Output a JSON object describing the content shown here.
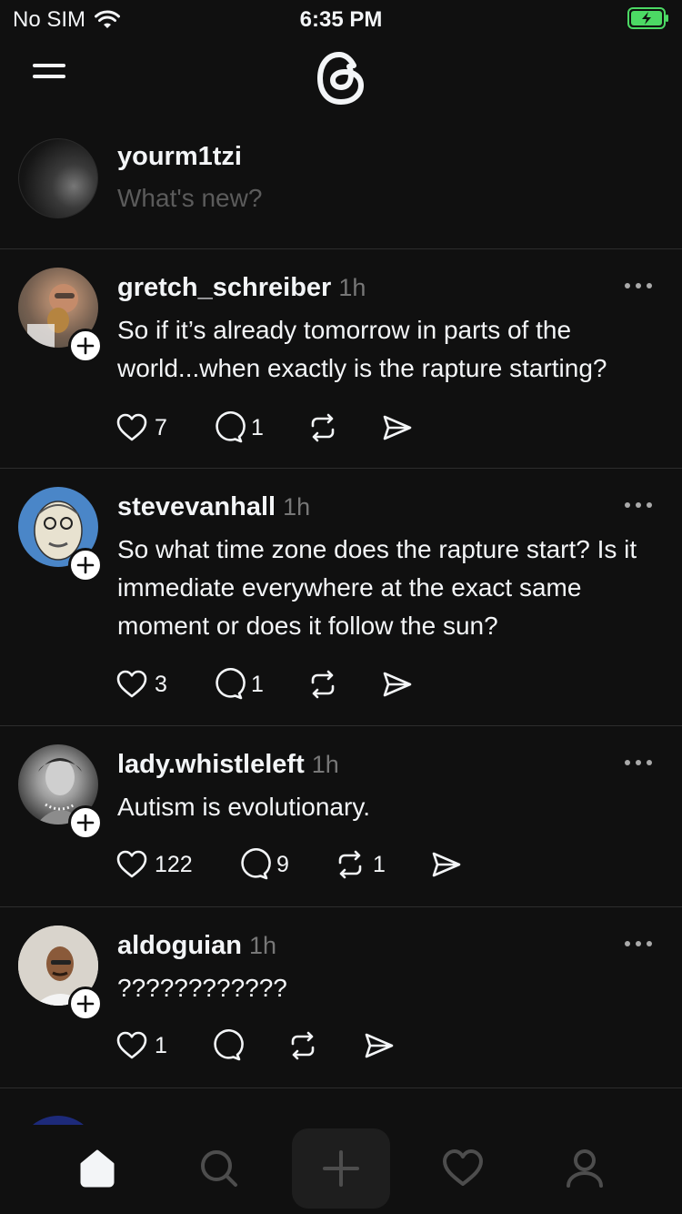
{
  "status": {
    "carrier": "No SIM",
    "time": "6:35 PM"
  },
  "composer": {
    "username": "yourm1tzi",
    "placeholder": "What's new?"
  },
  "posts": [
    {
      "username": "gretch_schreiber",
      "time": "1h",
      "text": "So if it’s already tomorrow in parts of the world...when exactly is the rapture starting?",
      "likes": "7",
      "replies": "1",
      "reposts": ""
    },
    {
      "username": "stevevanhall",
      "time": "1h",
      "text": "So what time zone does the rapture start? Is it immediate everywhere at the exact same moment or does it follow the sun?",
      "likes": "3",
      "replies": "1",
      "reposts": ""
    },
    {
      "username": "lady.whistleleft",
      "time": "1h",
      "text": "Autism is evolutionary.",
      "likes": "122",
      "replies": "9",
      "reposts": "1"
    },
    {
      "username": "aldoguian",
      "time": "1h",
      "text": "????????????",
      "likes": "1",
      "replies": "",
      "reposts": ""
    }
  ],
  "icons": {
    "menu": "menu-icon",
    "logo": "threads-logo-icon",
    "like": "heart-icon",
    "reply": "comment-icon",
    "repost": "repost-icon",
    "share": "send-icon",
    "more": "more-dots-icon",
    "tabs": [
      "home-icon",
      "search-icon",
      "plus-icon",
      "heart-icon",
      "profile-icon"
    ]
  },
  "colors": {
    "background": "#101010",
    "text": "#f3f5f7",
    "muted": "#777777",
    "divider": "#2d2d2d",
    "battery": "#4cd964"
  }
}
